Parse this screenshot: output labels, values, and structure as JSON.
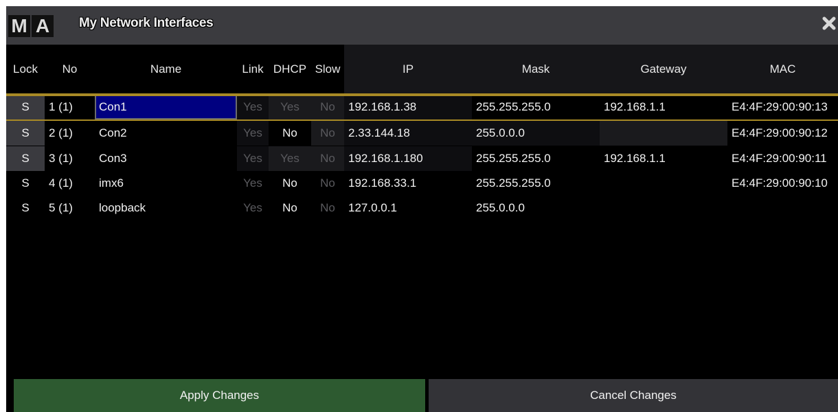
{
  "window": {
    "logo_letters": [
      "M",
      "A"
    ],
    "title": "My Network Interfaces",
    "close_icon": "close-x-icon"
  },
  "columns": [
    "Lock",
    "No",
    "Name",
    "Link",
    "DHCP",
    "Slow",
    "IP",
    "Mask",
    "Gateway",
    "MAC"
  ],
  "rows": [
    {
      "lock": "S",
      "no": "1 (1)",
      "name": "Con1",
      "link": "Yes",
      "dhcp": "Yes",
      "slow": "No",
      "ip": "192.168.1.38",
      "mask": "255.255.255.0",
      "gateway": "192.168.1.1",
      "mac": "E4:4F:29:00:90:13",
      "selected": true
    },
    {
      "lock": "S",
      "no": "2 (1)",
      "name": "Con2",
      "link": "Yes",
      "dhcp": "No",
      "slow": "No",
      "ip": "2.33.144.18",
      "mask": "255.0.0.0",
      "gateway": "",
      "mac": "E4:4F:29:00:90:12"
    },
    {
      "lock": "S",
      "no": "3 (1)",
      "name": "Con3",
      "link": "Yes",
      "dhcp": "Yes",
      "slow": "No",
      "ip": "192.168.1.180",
      "mask": "255.255.255.0",
      "gateway": "192.168.1.1",
      "mac": "E4:4F:29:00:90:11"
    },
    {
      "lock": "S",
      "no": "4 (1)",
      "name": "imx6",
      "link": "Yes",
      "dhcp": "No",
      "slow": "No",
      "ip": "192.168.33.1",
      "mask": "255.255.255.0",
      "gateway": "",
      "mac": "E4:4F:29:00:90:10"
    },
    {
      "lock": "S",
      "no": "5 (1)",
      "name": "loopback",
      "link": "Yes",
      "dhcp": "No",
      "slow": "No",
      "ip": "127.0.0.1",
      "mask": "255.0.0.0",
      "gateway": "",
      "mac": ""
    }
  ],
  "buttons": {
    "apply": "Apply Changes",
    "cancel": "Cancel Changes"
  },
  "colors": {
    "selection": "#000080",
    "accent_line": "#a88a25",
    "apply_bg": "#2d5a30",
    "cancel_bg": "#333337"
  }
}
